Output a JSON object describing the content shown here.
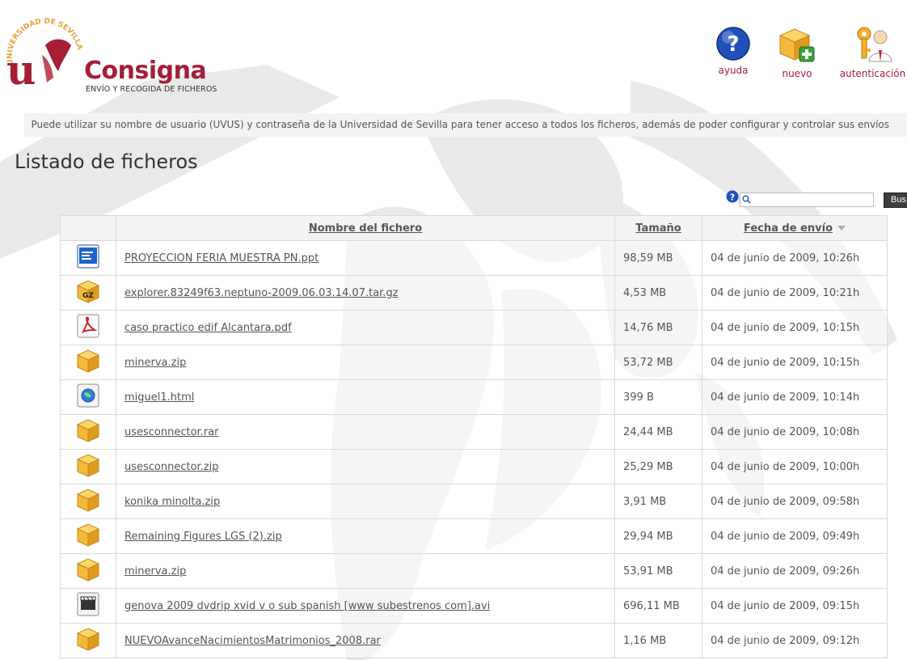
{
  "header": {
    "title": "Consigna",
    "subtitle": "ENVÍO Y RECOGIDA DE FICHEROS",
    "seal_text": "UNIVERSIDAD DE SEVILLA",
    "brand_color": "#a51e36"
  },
  "actions": [
    {
      "label": "ayuda",
      "icon": "help-icon"
    },
    {
      "label": "nuevo",
      "icon": "new-box-icon"
    },
    {
      "label": "autenticación",
      "icon": "keys-user-icon"
    }
  ],
  "info_text": "Puede utilizar su nombre de usuario (UVUS) y contraseña de la Universidad de Sevilla para tener acceso a todos los ficheros, además de poder configurar y controlar sus envíos",
  "page_title": "Listado de ficheros",
  "search": {
    "value": "",
    "button_label": "Bus"
  },
  "table": {
    "columns": [
      "Nombre del fichero",
      "Tamaño",
      "Fecha de envío"
    ],
    "rows": [
      {
        "icon": "presentation",
        "name": "PROYECCION FERIA MUESTRA PN.ppt",
        "size": "98,59 MB",
        "date": "04 de junio de 2009, 10:26h"
      },
      {
        "icon": "gz",
        "name": "explorer.83249f63.neptuno-2009.06.03.14.07.tar.gz",
        "size": "4,53 MB",
        "date": "04 de junio de 2009, 10:21h"
      },
      {
        "icon": "pdf",
        "name": "caso practico edif Alcantara.pdf",
        "size": "14,76 MB",
        "date": "04 de junio de 2009, 10:15h"
      },
      {
        "icon": "box",
        "name": "minerva.zip",
        "size": "53,72 MB",
        "date": "04 de junio de 2009, 10:15h"
      },
      {
        "icon": "html",
        "name": "miguel1.html",
        "size": "399 B",
        "date": "04 de junio de 2009, 10:14h"
      },
      {
        "icon": "box",
        "name": "usesconnector.rar",
        "size": "24,44 MB",
        "date": "04 de junio de 2009, 10:08h"
      },
      {
        "icon": "box",
        "name": "usesconnector.zip",
        "size": "25,29 MB",
        "date": "04 de junio de 2009, 10:00h"
      },
      {
        "icon": "box",
        "name": "konika minolta.zip",
        "size": "3,91 MB",
        "date": "04 de junio de 2009, 09:58h"
      },
      {
        "icon": "box",
        "name": "Remaining Figures LGS (2).zip",
        "size": "29,94 MB",
        "date": "04 de junio de 2009, 09:49h"
      },
      {
        "icon": "box",
        "name": "minerva.zip",
        "size": "53,91 MB",
        "date": "04 de junio de 2009, 09:26h"
      },
      {
        "icon": "video",
        "name": "genova 2009 dvdrip xvid v o sub spanish [www subestrenos com].avi",
        "size": "696,11 MB",
        "date": "04 de junio de 2009, 09:15h"
      },
      {
        "icon": "box",
        "name": "NUEVOAvanceNacimientosMatrimonios_2008.rar",
        "size": "1,16 MB",
        "date": "04 de junio de 2009, 09:12h"
      }
    ]
  }
}
